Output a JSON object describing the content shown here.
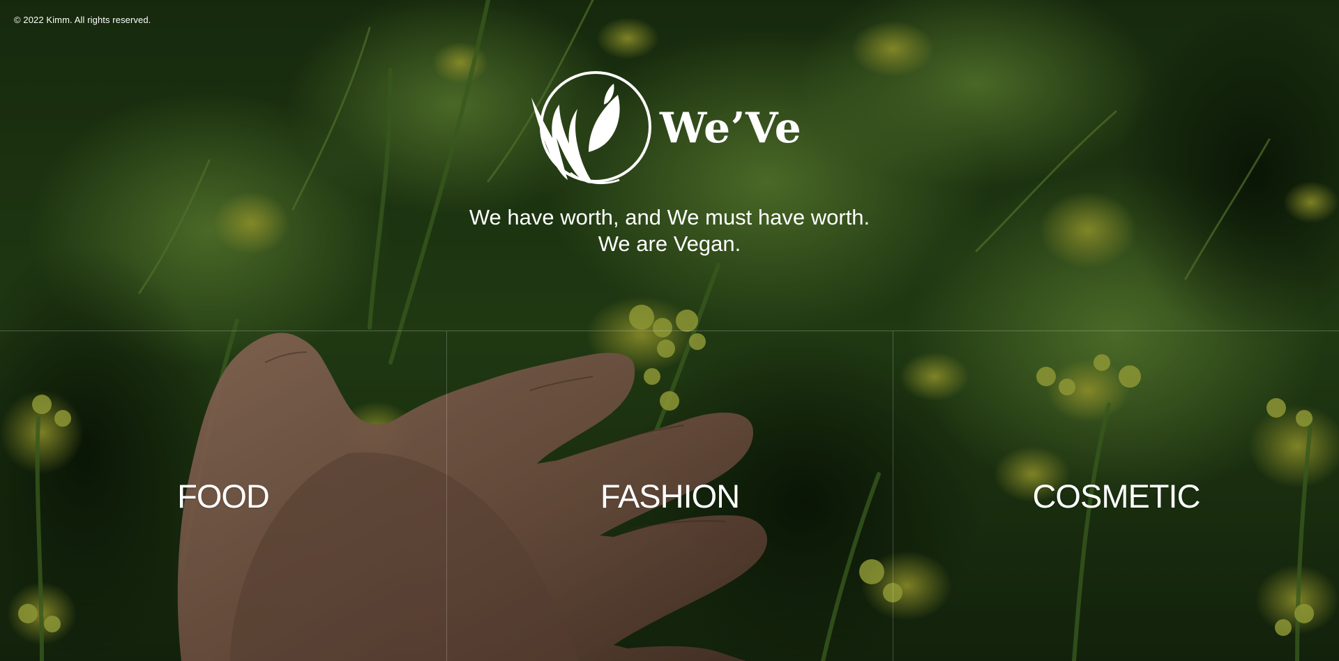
{
  "footer": {
    "copyright": "© 2022 Kimm. All rights reserved."
  },
  "brand": {
    "name": "We’Ve",
    "logo_icon": "leaf-w-circle-logo"
  },
  "tagline": {
    "line1": "We have worth, and We must have worth.",
    "line2": "We are Vegan."
  },
  "categories": [
    {
      "label": "FOOD"
    },
    {
      "label": "FASHION"
    },
    {
      "label": "COSMETIC"
    }
  ],
  "background": {
    "description_icon": "hand-in-flower-field-background",
    "overlay_color": "#000000"
  }
}
